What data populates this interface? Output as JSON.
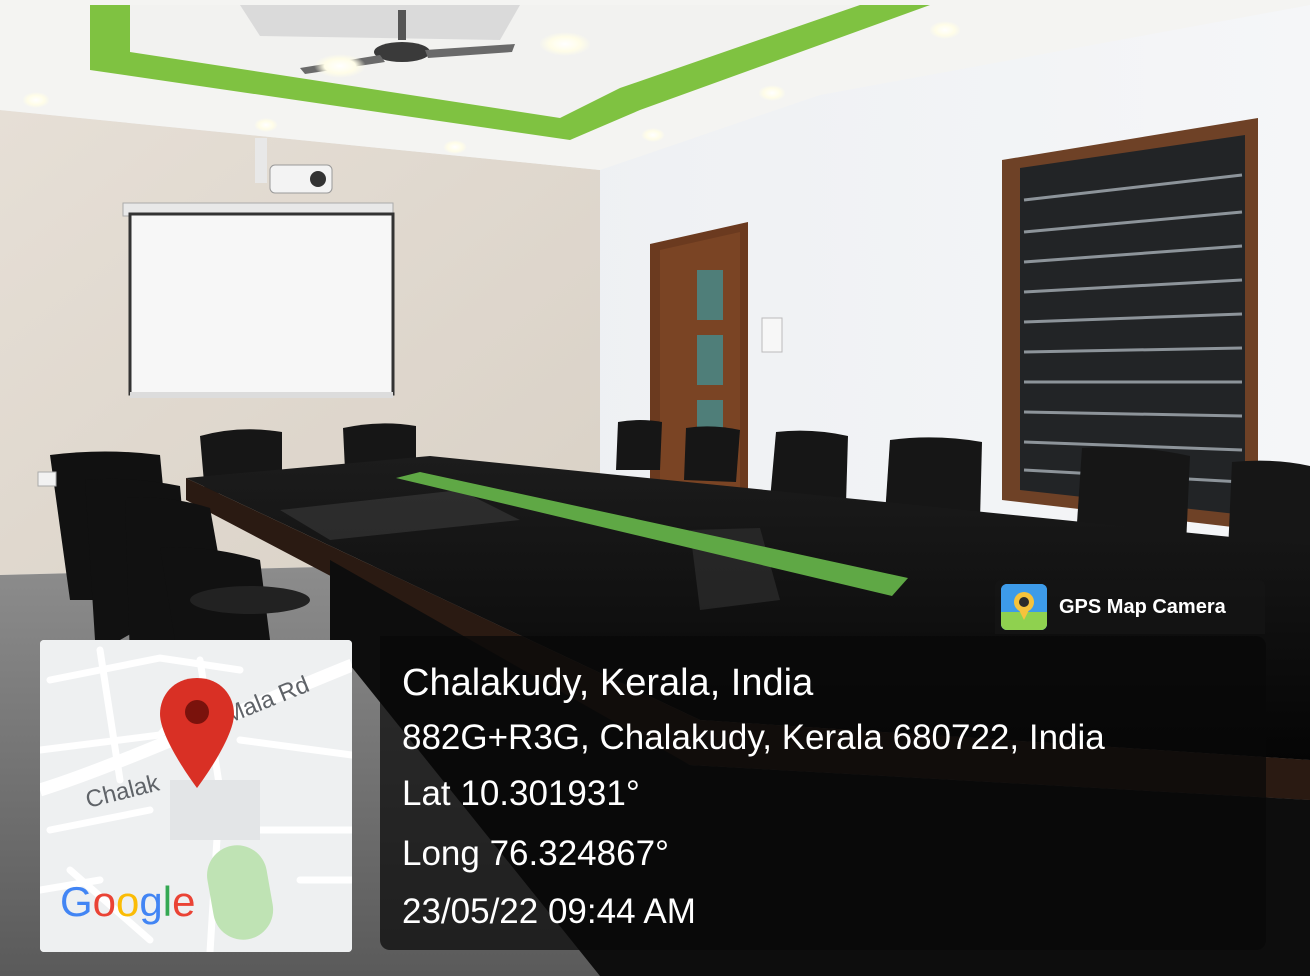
{
  "overlay": {
    "app_name": "GPS Map Camera",
    "app_icon": "gps-map-camera-icon",
    "location_title": "Chalakudy, Kerala, India",
    "address": "882G+R3G, Chalakudy, Kerala 680722, India",
    "latitude": "Lat 10.301931°",
    "longitude": "Long 76.324867°",
    "datetime": "23/05/22 09:44 AM"
  },
  "map": {
    "road_label_left": "Chalak",
    "road_label_right": "Mala Rd",
    "brand": "Google",
    "pin_icon": "map-pin-icon",
    "pin_color": "#d93025"
  },
  "colors": {
    "ceiling_accent": "#7fc241",
    "door_wood": "#6b3a1f",
    "table_top": "#121212"
  }
}
